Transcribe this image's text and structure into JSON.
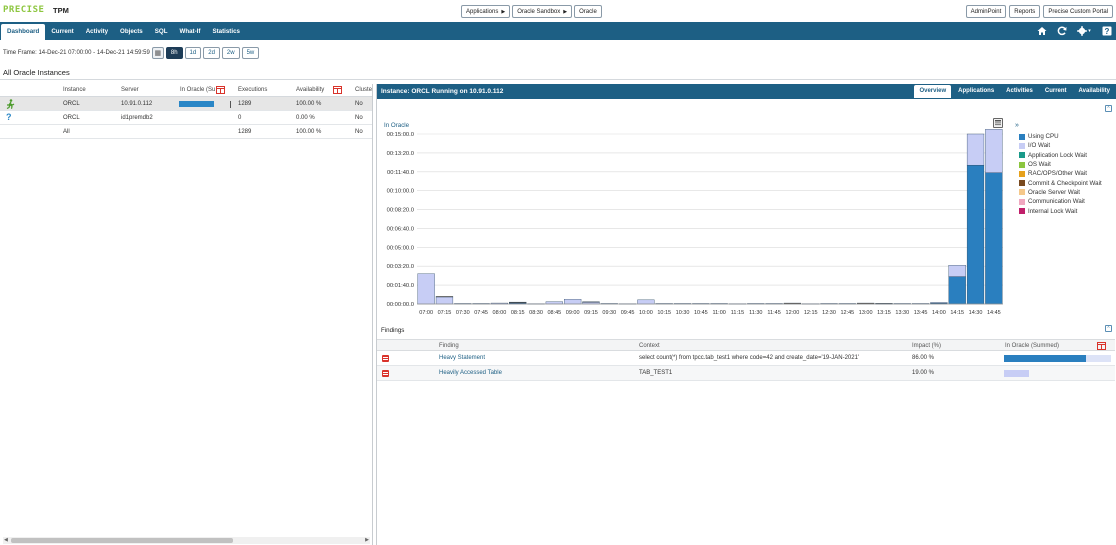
{
  "app": {
    "logo_text": "PRECISE",
    "product": "TPM"
  },
  "breadcrumbs": [
    {
      "label": "Applications"
    },
    {
      "label": "Oracle Sandbox"
    },
    {
      "label": "Oracle"
    }
  ],
  "top_buttons": [
    "AdminPoint",
    "Reports",
    "Precise Custom Portal"
  ],
  "nav_tabs": [
    "Dashboard",
    "Current",
    "Activity",
    "Objects",
    "SQL",
    "What-If",
    "Statistics"
  ],
  "nav_icons": [
    "home-icon",
    "refresh-icon",
    "settings-icon",
    "help-icon"
  ],
  "timeframe": {
    "label": "Time Frame: 14-Dec-21 07:00:00 - 14-Dec-21 14:59:59",
    "options": [
      "8h",
      "1d",
      "2d",
      "2w",
      "5w"
    ],
    "active": "8h"
  },
  "section_title": "All Oracle Instances",
  "instances": {
    "headers": [
      "Instance",
      "Server",
      "In Oracle (Su",
      "Executions",
      "Availability",
      "Cluste"
    ],
    "rows": [
      {
        "status_icon": "running-icon",
        "instance": "ORCL",
        "server": "10.91.0.112",
        "in_oracle_fraction": 0.67,
        "executions": "1289",
        "availability": "100.00 %",
        "cluster": "No",
        "selected": true
      },
      {
        "status_icon": "unknown-icon",
        "instance": "ORCL",
        "server": "id1premdb2",
        "in_oracle_fraction": 0,
        "executions": "0",
        "availability": "0.00 %",
        "cluster": "No",
        "selected": false
      },
      {
        "status_icon": "",
        "instance": "All",
        "server": "",
        "in_oracle_fraction": 0,
        "executions": "1289",
        "availability": "100.00 %",
        "cluster": "No",
        "selected": false
      }
    ]
  },
  "instance_panel": {
    "title": "Instance: ORCL Running on 10.91.0.112",
    "tabs": [
      "Overview",
      "Applications",
      "Activities",
      "Current",
      "Availability"
    ],
    "active_tab": "Overview"
  },
  "chart_data": {
    "type": "bar",
    "stacked": true,
    "title": "In Oracle",
    "y_ticks": [
      "00:00:00.0",
      "00:01:40.0",
      "00:03:20.0",
      "00:05:00.0",
      "00:06:40.0",
      "00:08:20.0",
      "00:10:00.0",
      "00:11:40.0",
      "00:13:20.0",
      "00:15:00.0"
    ],
    "ylim_seconds": [
      0,
      900
    ],
    "categories": [
      "07:00",
      "07:15",
      "07:30",
      "07:45",
      "08:00",
      "08:15",
      "08:30",
      "08:45",
      "09:00",
      "09:15",
      "09:30",
      "09:45",
      "10:00",
      "10:15",
      "10:30",
      "10:45",
      "11:00",
      "11:15",
      "11:30",
      "11:45",
      "12:00",
      "12:15",
      "12:30",
      "12:45",
      "13:00",
      "13:15",
      "13:30",
      "13:45",
      "14:00",
      "14:15",
      "14:30",
      "14:45"
    ],
    "series": [
      {
        "name": "Using CPU",
        "color": "#2a7fbf",
        "values": [
          0,
          0,
          0,
          0,
          0,
          5,
          0,
          0,
          0,
          0,
          0,
          0,
          0,
          0,
          0,
          0,
          0,
          0,
          0,
          0,
          0,
          0,
          0,
          0,
          0,
          0,
          0,
          0,
          5,
          145,
          735,
          695
        ]
      },
      {
        "name": "I/O Wait",
        "color": "#c7cdf5",
        "values": [
          160,
          38,
          3,
          3,
          5,
          2,
          2,
          12,
          25,
          10,
          3,
          2,
          22,
          3,
          3,
          3,
          3,
          2,
          3,
          3,
          3,
          2,
          3,
          3,
          3,
          2,
          3,
          3,
          3,
          60,
          165,
          230
        ]
      },
      {
        "name": "Application Lock Wait",
        "color": "#1a9a8a",
        "values": [
          0,
          0,
          0,
          0,
          0,
          0,
          0,
          0,
          0,
          0,
          0,
          0,
          0,
          0,
          0,
          0,
          0,
          0,
          0,
          0,
          0,
          0,
          0,
          0,
          0,
          0,
          0,
          0,
          0,
          0,
          0,
          0
        ]
      },
      {
        "name": "OS Wait",
        "color": "#8cc63f",
        "values": [
          0,
          0,
          0,
          0,
          0,
          0,
          0,
          0,
          0,
          0,
          0,
          0,
          0,
          0,
          0,
          0,
          0,
          0,
          0,
          0,
          0,
          0,
          0,
          0,
          0,
          0,
          0,
          0,
          0,
          0,
          0,
          0
        ]
      },
      {
        "name": "RAC/OPS/Other Wait",
        "color": "#e6a11b",
        "values": [
          0,
          0,
          0,
          0,
          0,
          0,
          0,
          0,
          0,
          0,
          0,
          0,
          0,
          0,
          0,
          0,
          0,
          0,
          0,
          0,
          0,
          0,
          0,
          0,
          0,
          0,
          0,
          0,
          0,
          0,
          0,
          0
        ]
      },
      {
        "name": "Commit & Checkpoint Wait",
        "color": "#7a4a20",
        "values": [
          0,
          2,
          0,
          0,
          0,
          3,
          0,
          0,
          0,
          2,
          0,
          0,
          0,
          0,
          0,
          0,
          0,
          0,
          0,
          0,
          2,
          0,
          0,
          0,
          2,
          2,
          0,
          0,
          0,
          0,
          0,
          0
        ]
      },
      {
        "name": "Oracle Server Wait",
        "color": "#f5c88a",
        "values": [
          0,
          0,
          0,
          0,
          0,
          0,
          0,
          0,
          0,
          0,
          0,
          0,
          0,
          0,
          0,
          0,
          0,
          0,
          0,
          0,
          0,
          0,
          0,
          0,
          0,
          0,
          0,
          0,
          0,
          0,
          0,
          0
        ]
      },
      {
        "name": "Communication Wait",
        "color": "#f0a8c0",
        "values": [
          0,
          0,
          0,
          0,
          0,
          0,
          0,
          0,
          0,
          0,
          0,
          0,
          0,
          0,
          0,
          0,
          0,
          0,
          0,
          0,
          0,
          0,
          0,
          0,
          0,
          0,
          0,
          0,
          0,
          0,
          0,
          0
        ]
      },
      {
        "name": "Internal Lock Wait",
        "color": "#c01f6a",
        "values": [
          0,
          0,
          0,
          0,
          0,
          0,
          0,
          0,
          0,
          0,
          0,
          0,
          0,
          0,
          0,
          0,
          0,
          0,
          0,
          0,
          0,
          0,
          0,
          0,
          0,
          0,
          0,
          0,
          0,
          0,
          0,
          0
        ]
      }
    ]
  },
  "findings": {
    "title": "Findings",
    "headers": [
      "Finding",
      "Context",
      "Impact (%)",
      "In Oracle (Summed)"
    ],
    "rows": [
      {
        "finding": "Heavy Statement",
        "context": "select count(*) from tpcc.tab_test1 where code=42 and create_date='19-JAN-2021'",
        "impact": "86.00 %",
        "bar_fraction": 0.77,
        "bar_color": "#2a7fbf"
      },
      {
        "finding": "Heavily Accessed Table",
        "context": "TAB_TEST1",
        "impact": "19.00 %",
        "bar_fraction": 0.23,
        "bar_color": "#c7cdf5"
      }
    ]
  }
}
